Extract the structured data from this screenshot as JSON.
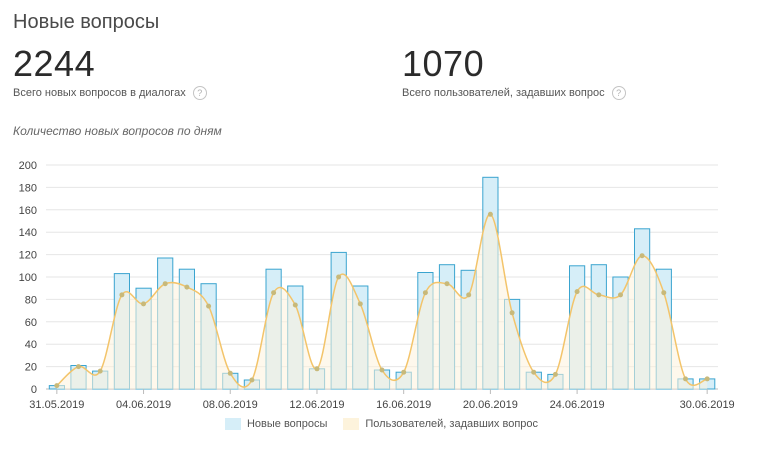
{
  "header": {
    "title": "Новые вопросы"
  },
  "stats": [
    {
      "value": "2244",
      "label": "Всего новых вопросов в диалогах"
    },
    {
      "value": "1070",
      "label": "Всего пользователей, задавших вопрос"
    }
  ],
  "help_glyph": "?",
  "chart_data": {
    "type": "bar",
    "title": "Количество новых вопросов по дням",
    "categories": [
      "31.05.2019",
      "01.06.2019",
      "02.06.2019",
      "03.06.2019",
      "04.06.2019",
      "05.06.2019",
      "06.06.2019",
      "07.06.2019",
      "08.06.2019",
      "09.06.2019",
      "10.06.2019",
      "11.06.2019",
      "12.06.2019",
      "13.06.2019",
      "14.06.2019",
      "15.06.2019",
      "16.06.2019",
      "17.06.2019",
      "18.06.2019",
      "19.06.2019",
      "20.06.2019",
      "21.06.2019",
      "22.06.2019",
      "23.06.2019",
      "24.06.2019",
      "25.06.2019",
      "26.06.2019",
      "27.06.2019",
      "28.06.2019",
      "29.06.2019",
      "30.06.2019"
    ],
    "x_tick_labels": [
      "31.05.2019",
      "04.06.2019",
      "08.06.2019",
      "12.06.2019",
      "16.06.2019",
      "20.06.2019",
      "24.06.2019",
      "30.06.2019"
    ],
    "series": [
      {
        "name": "Новые вопросы",
        "type": "bar",
        "color": "#d6eef8",
        "stroke": "#3aa4cf",
        "values": [
          3,
          21,
          16,
          103,
          90,
          117,
          107,
          94,
          14,
          8,
          107,
          92,
          18,
          122,
          92,
          17,
          15,
          104,
          111,
          106,
          189,
          80,
          15,
          13,
          110,
          111,
          100,
          143,
          107,
          9,
          9
        ]
      },
      {
        "name": "Пользователей, задавших вопрос",
        "type": "line",
        "color": "#f3c46a",
        "fill": "#fdf3dc",
        "values": [
          3,
          20,
          16,
          84,
          76,
          94,
          91,
          74,
          14,
          8,
          86,
          75,
          18,
          100,
          76,
          17,
          15,
          86,
          94,
          84,
          156,
          68,
          15,
          13,
          87,
          84,
          84,
          119,
          86,
          9,
          9
        ]
      }
    ],
    "ylim": [
      0,
      200
    ],
    "y_ticks": [
      0,
      20,
      40,
      60,
      80,
      100,
      120,
      140,
      160,
      180,
      200
    ],
    "grid": true,
    "legend_position": "bottom-center"
  }
}
